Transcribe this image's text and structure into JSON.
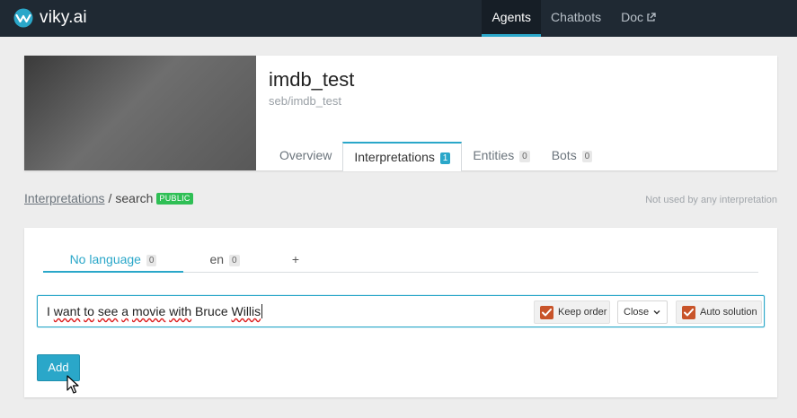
{
  "navbar": {
    "logo_text": "viky.ai",
    "links": [
      {
        "label": "Agents"
      },
      {
        "label": "Chatbots"
      },
      {
        "label": "Doc"
      }
    ],
    "accent": "#2aa7c9"
  },
  "agent": {
    "name": "imdb_test",
    "slug": "seb/imdb_test",
    "tabs": [
      {
        "label": "Overview"
      },
      {
        "label": "Interpretations",
        "count": "1"
      },
      {
        "label": "Entities",
        "count": "0"
      },
      {
        "label": "Bots",
        "count": "0"
      }
    ]
  },
  "breadcrumb": {
    "parent": "Interpretations",
    "separator": "/",
    "current": "search",
    "badge": "PUBLIC"
  },
  "usage_note": "Not used by any interpretation",
  "language_tabs": [
    {
      "label": "No language",
      "count": "0"
    },
    {
      "label": "en",
      "count": "0"
    },
    {
      "label": "+"
    }
  ],
  "sentence": {
    "words": [
      "I",
      "want",
      "to",
      "see",
      "a",
      "movie",
      "with",
      "Bruce",
      "Willis"
    ]
  },
  "options": {
    "keep_order": "Keep order",
    "proximity": "Close",
    "auto_solution": "Auto solution"
  },
  "add_button": "Add",
  "icons": [
    "viky-logo-icon",
    "external-link-icon",
    "checkbox-checked-icon",
    "chevron-down-icon",
    "mouse-pointer-icon"
  ]
}
